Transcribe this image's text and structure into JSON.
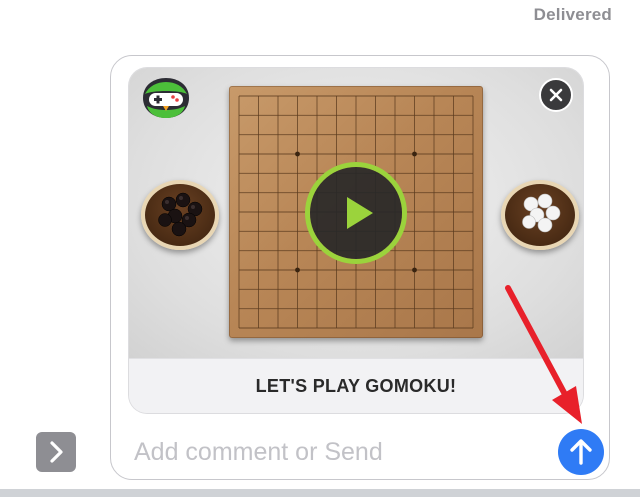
{
  "status": {
    "delivered": "Delivered"
  },
  "game": {
    "caption": "LET'S PLAY GOMOKU!",
    "logo_icon": "game-controller-bird-icon",
    "close_icon": "close-icon",
    "play_icon": "play-icon",
    "board": "gomoku-board",
    "accent_color": "#9bd33c"
  },
  "composer": {
    "placeholder": "Add comment or Send",
    "send_icon": "arrow-up-icon",
    "expand_icon": "chevron-right-icon",
    "send_color": "#2f7bf5"
  },
  "annotation": {
    "arrow_color": "#e8202a"
  }
}
